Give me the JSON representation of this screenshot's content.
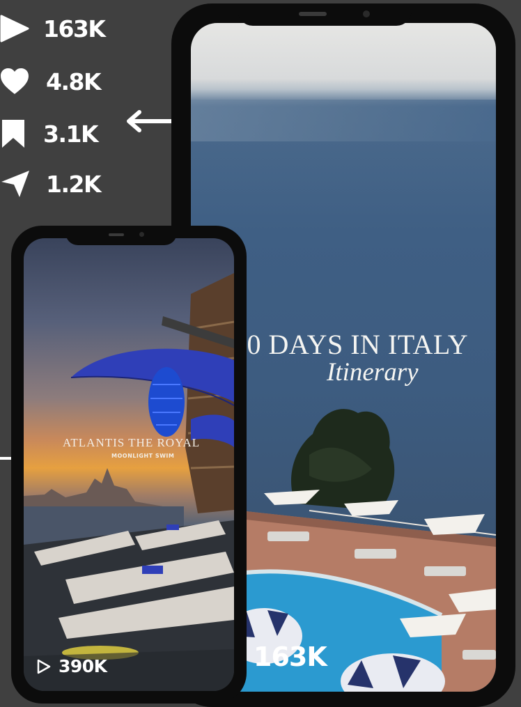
{
  "stats": {
    "views": "163K",
    "likes": "4.8K",
    "saves": "3.1K",
    "shares": "1.2K"
  },
  "main_video": {
    "title": "10 DAYS IN ITALY",
    "subtitle": "Itinerary",
    "views": "163K"
  },
  "second_video": {
    "title": "ATLANTIS THE ROYAL",
    "subtitle": "MOONLIGHT SWIM",
    "views": "390K"
  },
  "colors": {
    "background": "#404040",
    "phone_frame": "#0c0c0c",
    "text": "#ffffff",
    "umbrella_blue": "#2f3fb8"
  }
}
